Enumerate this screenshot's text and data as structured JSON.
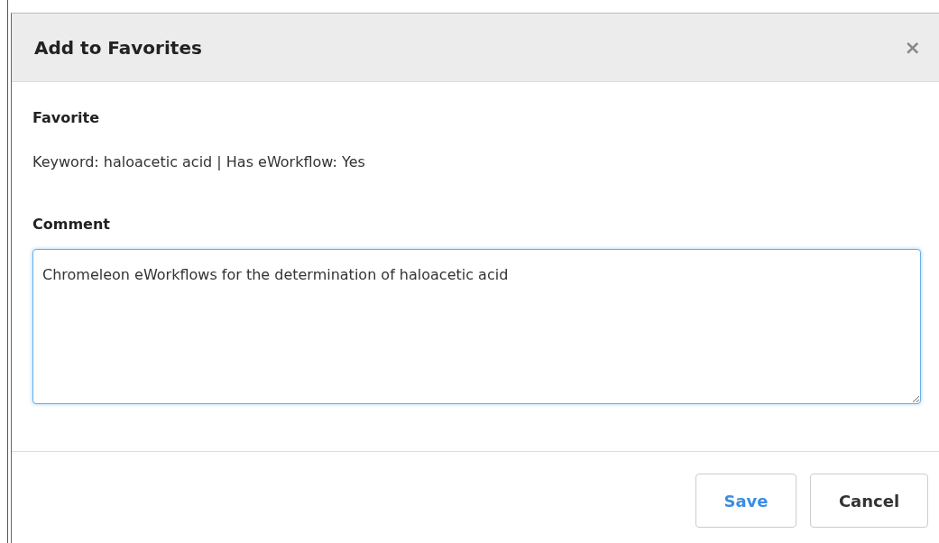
{
  "dialog": {
    "title": "Add to Favorites",
    "close": "×"
  },
  "favorite": {
    "label": "Favorite",
    "value": "Keyword: haloacetic acid | Has eWorkflow: Yes"
  },
  "comment": {
    "label": "Comment",
    "value": "Chromeleon eWorkflows for the determination of haloacetic acid"
  },
  "buttons": [
    {
      "label": "Save",
      "kind": "primary"
    },
    {
      "label": "Cancel",
      "kind": "default"
    }
  ]
}
